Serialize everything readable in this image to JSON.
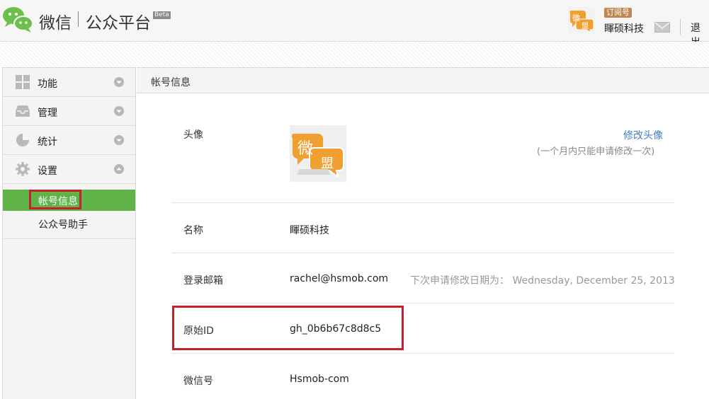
{
  "header": {
    "brand_wechat": "微信",
    "brand_platform": "公众平台",
    "beta": "Beta",
    "account_type": "订阅号",
    "account_name": "睴硕科技",
    "logout": "退出",
    "logo_icon": "wechat-logo-icon",
    "mail_icon": "envelope-icon",
    "avatar_text": "微盟"
  },
  "sidebar": {
    "items": [
      {
        "label": "功能",
        "icon": "grid-icon",
        "chevron": "chevron-down-icon"
      },
      {
        "label": "管理",
        "icon": "inbox-icon",
        "chevron": "chevron-down-icon"
      },
      {
        "label": "统计",
        "icon": "pie-chart-icon",
        "chevron": "chevron-down-icon"
      },
      {
        "label": "设置",
        "icon": "gear-icon",
        "chevron": "chevron-up-icon"
      }
    ],
    "submenu": [
      {
        "label": "帐号信息",
        "active": true
      },
      {
        "label": "公众号助手",
        "active": false
      }
    ],
    "active_color": "#5fb348"
  },
  "main": {
    "section_title": "帐号信息",
    "avatar": {
      "label": "头像",
      "change_link": "修改头像",
      "note": "(一个月内只能申请修改一次)",
      "image_text": "微盟"
    },
    "name": {
      "label": "名称",
      "value": "睴硕科技"
    },
    "email": {
      "label": "登录邮箱",
      "value": "rachel@hsmob.com",
      "note": "下次申请修改日期为： Wednesday, December 25, 2013"
    },
    "original_id": {
      "label": "原始ID",
      "value": "gh_0b6b67c8d8c5"
    },
    "wechat_id": {
      "label": "微信号",
      "value": "Hsmob-com"
    }
  },
  "colors": {
    "highlight_box": "#c8202a",
    "link": "#3d7fc0",
    "avatar_orange": "#f0a030"
  }
}
